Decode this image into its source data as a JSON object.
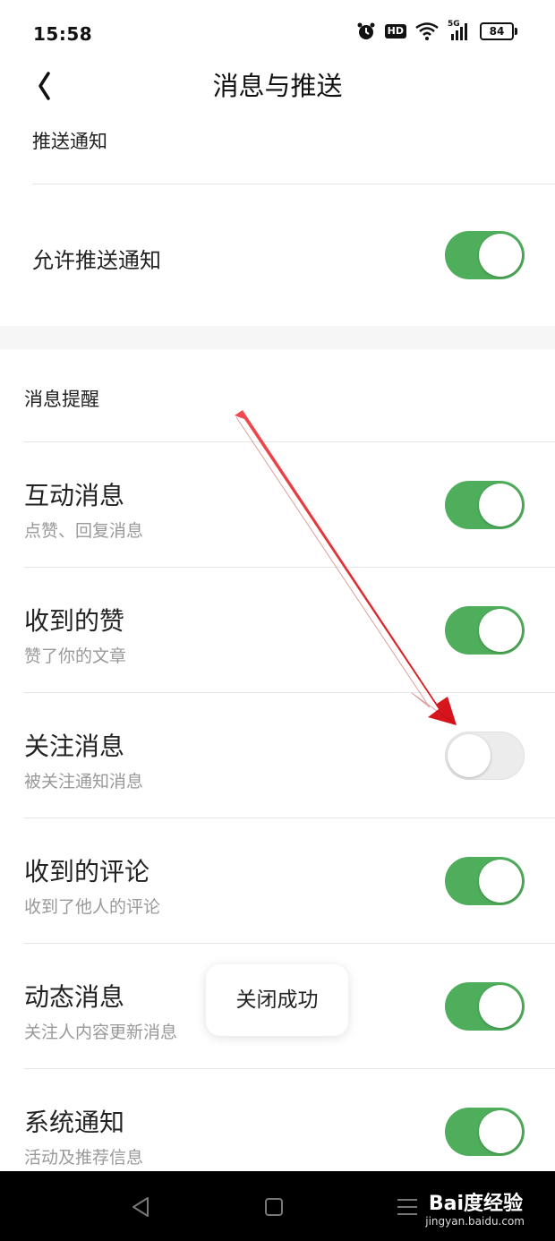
{
  "status_bar": {
    "time": "15:58",
    "hd_label": "HD",
    "network_label": "5G",
    "battery_level": "84"
  },
  "header": {
    "title": "消息与推送",
    "back_icon": "chevron-left-icon"
  },
  "push_section": {
    "title": "推送通知",
    "allow_label": "允许推送通知",
    "allow_on": true
  },
  "reminder_section": {
    "title": "消息提醒",
    "items": [
      {
        "title": "互动消息",
        "subtitle": "点赞、回复消息",
        "on": true
      },
      {
        "title": "收到的赞",
        "subtitle": "赞了你的文章",
        "on": true
      },
      {
        "title": "关注消息",
        "subtitle": "被关注通知消息",
        "on": false
      },
      {
        "title": "收到的评论",
        "subtitle": "收到了他人的评论",
        "on": true
      },
      {
        "title": "动态消息",
        "subtitle": "关注人内容更新消息",
        "on": true
      },
      {
        "title": "系统通知",
        "subtitle": "活动及推荐信息",
        "on": true
      }
    ]
  },
  "toast": {
    "text": "关闭成功"
  },
  "watermark": {
    "brand": "Bai度经验",
    "url": "jingyan.baidu.com"
  },
  "colors": {
    "toggle_on": "#4fae5b",
    "toggle_off": "#ececec",
    "annotation_arrow": "#e8141c"
  }
}
